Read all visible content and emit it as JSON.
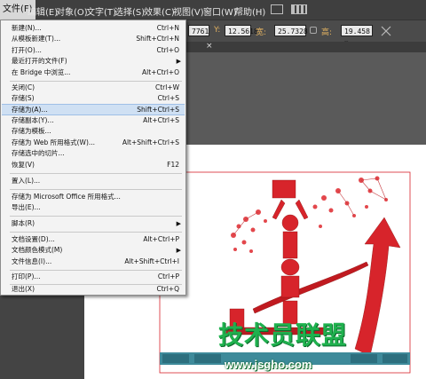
{
  "menubar": {
    "items": [
      "文件(F)",
      "编辑(E)",
      "对象(O)",
      "文字(T)",
      "选择(S)",
      "效果(C)",
      "视图(V)",
      "窗口(W)",
      "帮助(H)"
    ]
  },
  "toolbar": {
    "x_partial": "7761",
    "y_label": "Y:",
    "y_value": "12.5618",
    "w_label": "宽:",
    "w_value": "25.7328",
    "h_label": "高:",
    "h_value": "19.458 m"
  },
  "tab": {
    "close": "×"
  },
  "file_menu": {
    "items": [
      {
        "label": "新建(N)...",
        "shortcut": "Ctrl+N"
      },
      {
        "label": "从模板新建(T)...",
        "shortcut": "Shift+Ctrl+N"
      },
      {
        "label": "打开(O)...",
        "shortcut": "Ctrl+O"
      },
      {
        "label": "最近打开的文件(F)",
        "arrow": "▶"
      },
      {
        "label": "在 Bridge 中浏览...",
        "shortcut": "Alt+Ctrl+O"
      },
      {
        "label": "关闭(C)",
        "shortcut": "Ctrl+W"
      },
      {
        "label": "存储(S)",
        "shortcut": "Ctrl+S"
      },
      {
        "label": "存储为(A)...",
        "shortcut": "Shift+Ctrl+S"
      },
      {
        "label": "存储副本(Y)...",
        "shortcut": "Alt+Ctrl+S"
      },
      {
        "label": "存储为模板..."
      },
      {
        "label": "存储为 Web 所用格式(W)...",
        "shortcut": "Alt+Shift+Ctrl+S"
      },
      {
        "label": "存储选中的切片..."
      },
      {
        "label": "恢复(V)",
        "shortcut": "F12"
      },
      {
        "label": "置入(L)..."
      },
      {
        "label": "存储为 Microsoft Office 所用格式..."
      },
      {
        "label": "导出(E)..."
      },
      {
        "label": "脚本(R)",
        "arrow": "▶"
      },
      {
        "label": "文档设置(D)...",
        "shortcut": "Alt+Ctrl+P"
      },
      {
        "label": "文档颜色模式(M)",
        "arrow": "▶"
      },
      {
        "label": "文件信息(I)...",
        "shortcut": "Alt+Shift+Ctrl+I"
      },
      {
        "label": "打印(P)...",
        "shortcut": "Ctrl+P"
      },
      {
        "label": "退出(X)",
        "shortcut": "Ctrl+Q"
      }
    ]
  },
  "watermark": {
    "text": "技术员联盟",
    "url": "www.jsgho.com"
  },
  "colors": {
    "artwork_red": "#d7242b",
    "watermark_green": "#1fb14e",
    "highlight": "#cfe0f3"
  }
}
